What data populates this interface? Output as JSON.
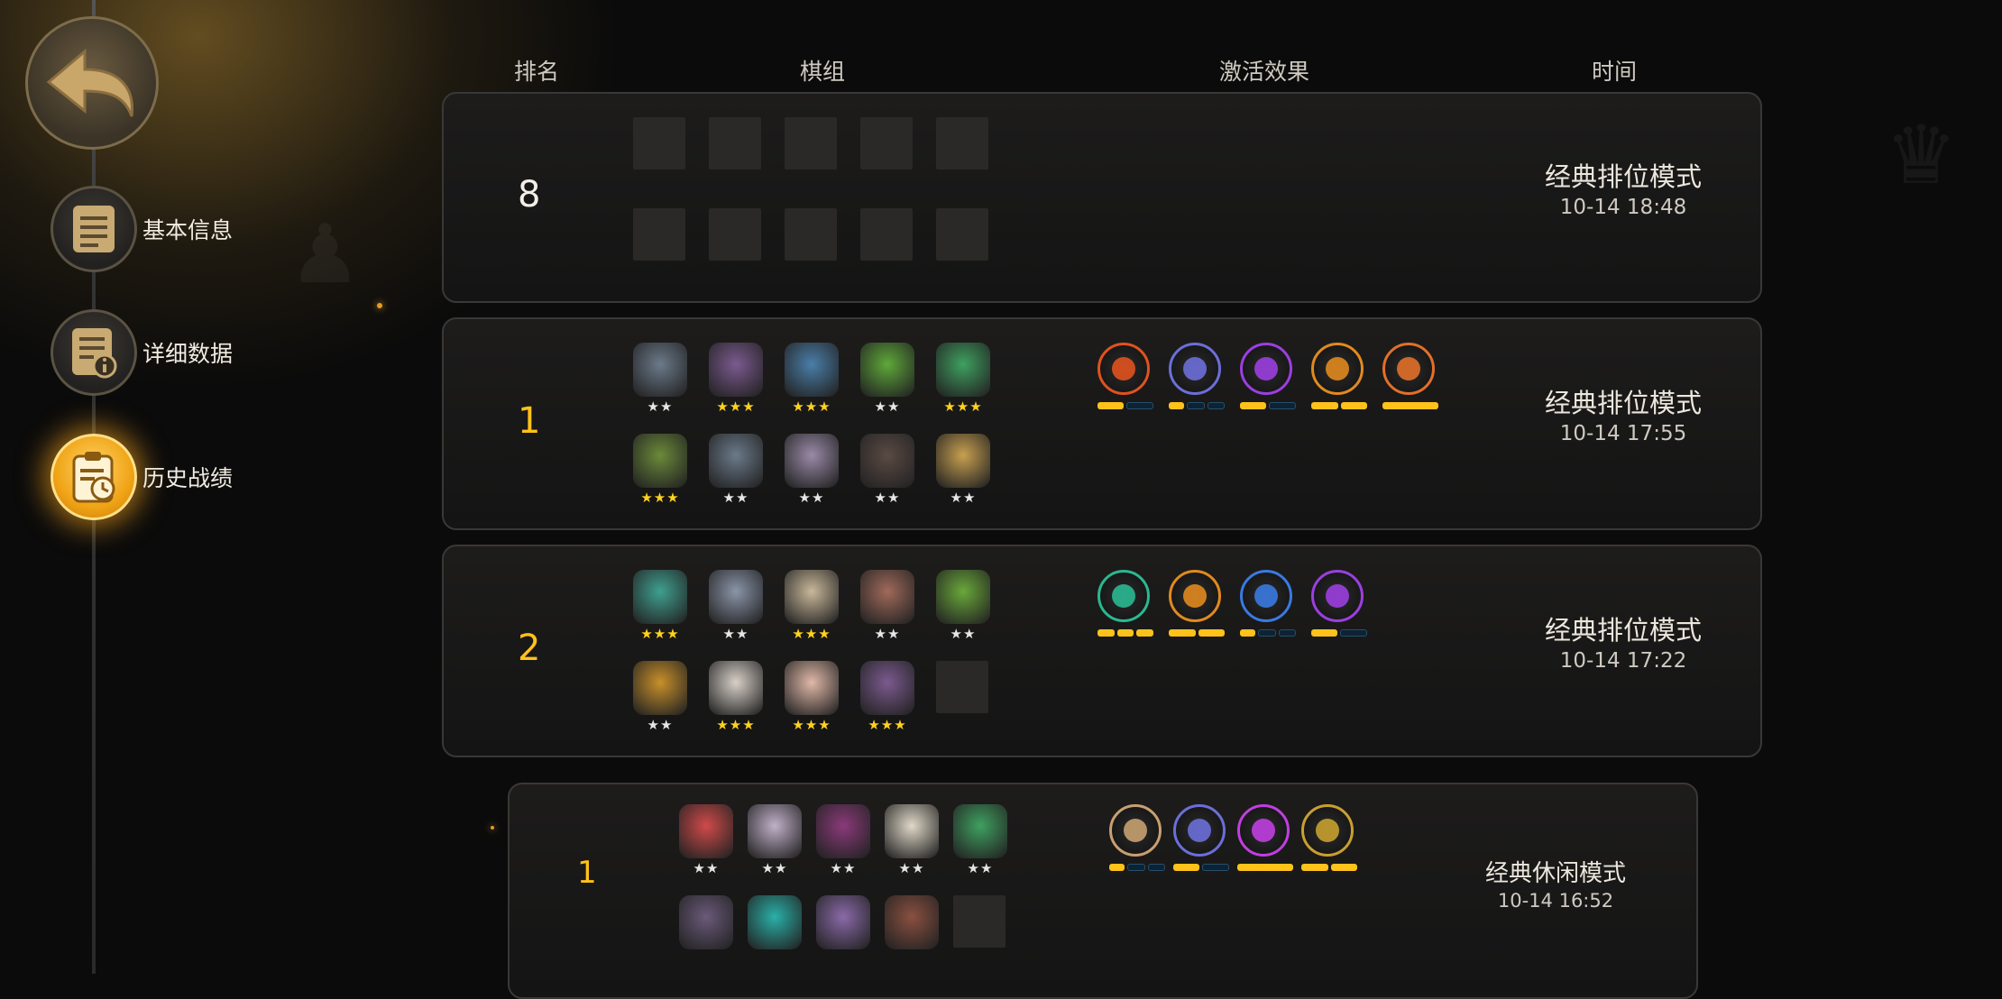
{
  "header": {
    "rank": "排名",
    "lineup": "棋组",
    "traits": "激活效果",
    "time": "时间"
  },
  "sidebar": {
    "items": [
      {
        "label": "基本信息",
        "icon": "document-icon",
        "active": false
      },
      {
        "label": "详细数据",
        "icon": "document-info-icon",
        "active": false
      },
      {
        "label": "历史战绩",
        "icon": "clipboard-clock-icon",
        "active": true
      }
    ]
  },
  "matches": [
    {
      "rank": "8",
      "rank_color": "white",
      "mode": "经典排位模式",
      "time": "10-14 18:48",
      "pieces": [],
      "traits": []
    },
    {
      "rank": "1",
      "rank_color": "gold",
      "mode": "经典排位模式",
      "time": "10-14 17:55",
      "pieces": [
        {
          "color": "#6b7a8a",
          "stars": "★★",
          "star_color": "silver"
        },
        {
          "color": "#7b5a8f",
          "stars": "★★★",
          "star_color": "gold"
        },
        {
          "color": "#4a7ea8",
          "stars": "★★★",
          "star_color": "gold"
        },
        {
          "color": "#5fa83a",
          "stars": "★★",
          "star_color": "silver"
        },
        {
          "color": "#3fa060",
          "stars": "★★★",
          "star_color": "gold"
        },
        {
          "color": "#6b8a3a",
          "stars": "★★★",
          "star_color": "gold"
        },
        {
          "color": "#6b7a8a",
          "stars": "★★",
          "star_color": "silver"
        },
        {
          "color": "#9a8aa8",
          "stars": "★★",
          "star_color": "silver"
        },
        {
          "color": "#5a4a44",
          "stars": "★★",
          "star_color": "silver"
        },
        {
          "color": "#c8a050",
          "stars": "★★",
          "star_color": "silver"
        }
      ],
      "traits": [
        {
          "color": "#e0521f",
          "bars": [
            1,
            0
          ]
        },
        {
          "color": "#6b6fd8",
          "bars": [
            1,
            0,
            0
          ]
        },
        {
          "color": "#9b3fe0",
          "bars": [
            1,
            0
          ]
        },
        {
          "color": "#e08a1f",
          "bars": [
            1,
            1
          ]
        },
        {
          "color": "#e0702a",
          "bars": [
            1
          ]
        }
      ]
    },
    {
      "rank": "2",
      "rank_color": "gold",
      "mode": "经典排位模式",
      "time": "10-14 17:22",
      "pieces": [
        {
          "color": "#3fa090",
          "stars": "★★★",
          "star_color": "gold"
        },
        {
          "color": "#8a95a8",
          "stars": "★★",
          "star_color": "silver"
        },
        {
          "color": "#c9b89a",
          "stars": "★★★",
          "star_color": "gold"
        },
        {
          "color": "#a06a5a",
          "stars": "★★",
          "star_color": "silver"
        },
        {
          "color": "#6aa83a",
          "stars": "★★",
          "star_color": "silver"
        },
        {
          "color": "#c8902a",
          "stars": "★★",
          "star_color": "silver"
        },
        {
          "color": "#d8d0c8",
          "stars": "★★★",
          "star_color": "gold"
        },
        {
          "color": "#e0b8a8",
          "stars": "★★★",
          "star_color": "gold"
        },
        {
          "color": "#7b5a8f",
          "stars": "★★★",
          "star_color": "gold"
        }
      ],
      "traits": [
        {
          "color": "#2ab890",
          "bars": [
            1,
            1,
            1
          ]
        },
        {
          "color": "#e08a1f",
          "bars": [
            1,
            1
          ]
        },
        {
          "color": "#3a7ae0",
          "bars": [
            1,
            0,
            0
          ]
        },
        {
          "color": "#9b3fe0",
          "bars": [
            1,
            0
          ]
        }
      ]
    },
    {
      "rank": "1",
      "rank_color": "gold",
      "mode": "经典休闲模式",
      "time": "10-14 16:52",
      "pieces": [
        {
          "color": "#d04a4a",
          "stars": "★★",
          "star_color": "silver"
        },
        {
          "color": "#c0b0c8",
          "stars": "★★",
          "star_color": "silver"
        },
        {
          "color": "#8a3a7a",
          "stars": "★★",
          "star_color": "silver"
        },
        {
          "color": "#e0d8c8",
          "stars": "★★",
          "star_color": "silver"
        },
        {
          "color": "#3fa060",
          "stars": "★★",
          "star_color": "silver"
        },
        {
          "color": "#6a5a7a",
          "stars": "",
          "star_color": "silver"
        },
        {
          "color": "#2ab0a8",
          "stars": "",
          "star_color": "silver"
        },
        {
          "color": "#8a6aa8",
          "stars": "",
          "star_color": "silver"
        },
        {
          "color": "#8a5040",
          "stars": "",
          "star_color": "silver"
        }
      ],
      "traits": [
        {
          "color": "#c8a070",
          "bars": [
            1,
            0,
            0
          ]
        },
        {
          "color": "#6b6fd8",
          "bars": [
            1,
            0
          ]
        },
        {
          "color": "#c03fe0",
          "bars": [
            1
          ]
        },
        {
          "color": "#c8a030",
          "bars": [
            1,
            1
          ]
        }
      ]
    }
  ]
}
